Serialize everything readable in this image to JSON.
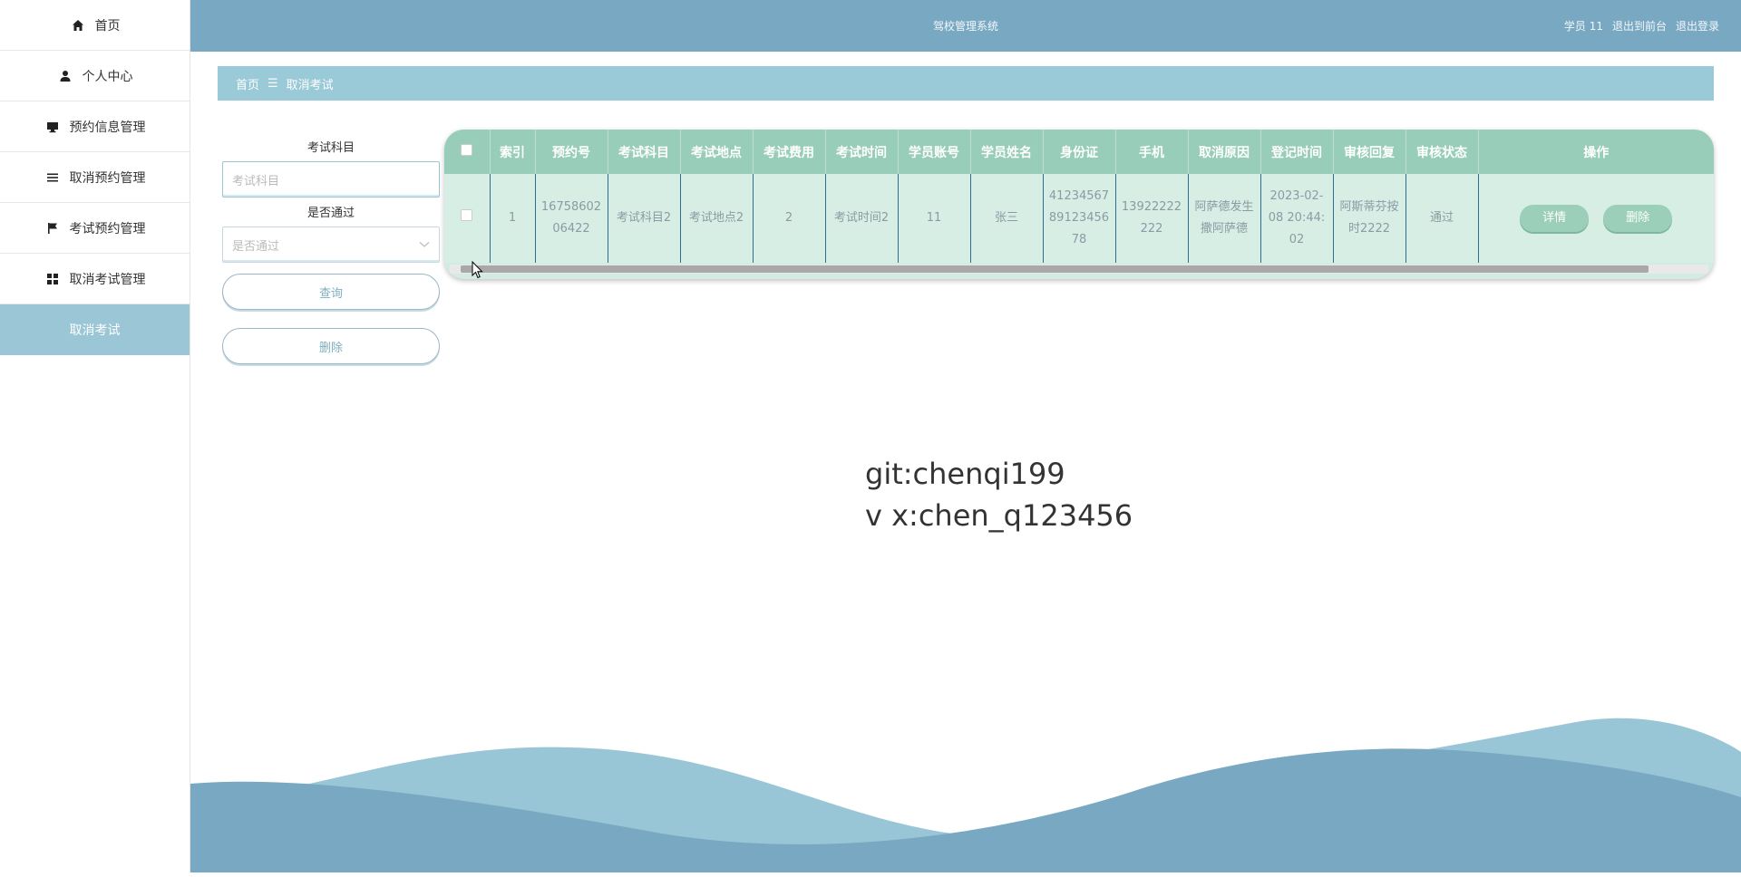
{
  "sidebar": {
    "items": [
      {
        "label": "首页",
        "icon": "home-icon"
      },
      {
        "label": "个人中心",
        "icon": "user-icon"
      },
      {
        "label": "预约信息管理",
        "icon": "monitor-icon"
      },
      {
        "label": "取消预约管理",
        "icon": "list-icon"
      },
      {
        "label": "考试预约管理",
        "icon": "flag-icon"
      },
      {
        "label": "取消考试管理",
        "icon": "grid-icon"
      },
      {
        "label": "取消考试",
        "icon": ""
      }
    ]
  },
  "header": {
    "title": "驾校管理系统",
    "user": "学员 11",
    "to_front": "退出到前台",
    "logout": "退出登录"
  },
  "breadcrumb": {
    "home": "首页",
    "sep": "☰",
    "current": "取消考试"
  },
  "search": {
    "subject_label": "考试科目",
    "subject_placeholder": "考试科目",
    "passed_label": "是否通过",
    "passed_placeholder": "是否通过",
    "query_button": "查询",
    "delete_button": "删除"
  },
  "table": {
    "columns": [
      "索引",
      "预约号",
      "考试科目",
      "考试地点",
      "考试费用",
      "考试时间",
      "学员账号",
      "学员姓名",
      "身份证",
      "手机",
      "取消原因",
      "登记时间",
      "审核回复",
      "审核状态",
      "操作"
    ],
    "rows": [
      {
        "index": "1",
        "booking_no": "1675860206422",
        "subject": "考试科目2",
        "location": "考试地点2",
        "fee": "2",
        "time": "考试时间2",
        "account": "11",
        "name": "张三",
        "id_card": "412345678912345678",
        "phone": "13922222222",
        "reason": "阿萨德发生撒阿萨德",
        "reg_time": "2023-02-08 20:44:02",
        "reply": "阿斯蒂芬按时2222",
        "status": "通过",
        "detail_button": "详情",
        "delete_button": "删除"
      }
    ]
  },
  "watermark": {
    "line1": "git:chenqi199",
    "line2": "v x:chen_q123456"
  },
  "colors": {
    "topbar": "#79a9c2",
    "breadcrumb": "#9ac9d8",
    "table_header": "#98cdb9",
    "table_row": "#d7eee5",
    "active_sidebar": "#9ac6d6"
  }
}
